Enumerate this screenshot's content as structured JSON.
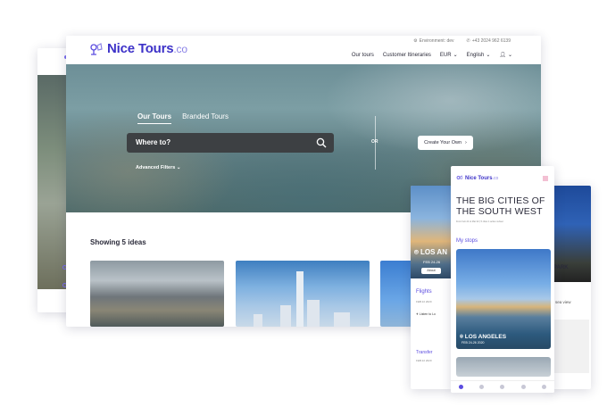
{
  "brand": {
    "name": "Nice Tours",
    "suffix": ".co",
    "color": "#3d32c8"
  },
  "topbar": {
    "environment": "Environment: dev",
    "phone": "+43 2024 962 6139"
  },
  "menu": {
    "our_tours": "Our tours",
    "customer_itineraries": "Customer Itineraries",
    "currency": "EUR",
    "language": "English"
  },
  "hero": {
    "tab_our_tours": "Our Tours",
    "tab_branded_tours": "Branded Tours",
    "search_placeholder": "Where to?",
    "advanced_filters": "Advanced Filters",
    "or": "OR",
    "create_button": "Create Your Own"
  },
  "results": {
    "showing": "Showing 5 ideas"
  },
  "phone_left": {
    "city": "LOS AN",
    "date": "FEB 24-26",
    "button": "About",
    "flights": "Flights",
    "flights_date": "FEB 22 2020",
    "listen": "Listen to Lo",
    "transfer": "Transfer",
    "transfer_date": "FEB 22 2020"
  },
  "phone_mid": {
    "brand": "Nice Tours",
    "brand_suffix": ".co",
    "title": "THE BIG CITIES OF THE SOUTH WEST",
    "subtitle": "From Feb 24 to Mar 02 | 5 cities 1 active subset",
    "my_stops": "My stops",
    "city": "LOS ANGELES",
    "date": "FEB 24-26 2020"
  },
  "phone_right": {
    "park": "PARK",
    "view": "sea view"
  },
  "colors": {
    "accent": "#5b4ce0",
    "search_bg": "#3d4043"
  }
}
